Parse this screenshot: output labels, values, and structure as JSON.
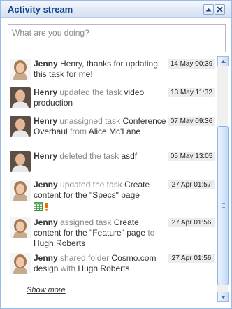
{
  "panel": {
    "title": "Activity stream",
    "collapse_icon": "chevron-up-icon",
    "close_icon": "close-icon"
  },
  "status_input": {
    "placeholder": "What are you doing?",
    "value": ""
  },
  "entries": [
    {
      "actor": "Jenny",
      "avatar": "woman-avatar",
      "text": "Henry, thanks for updating this task for me!",
      "time": "14 May 00:39"
    },
    {
      "actor": "Henry",
      "avatar": "man-avatar",
      "verb": "updated the task",
      "object": "video production",
      "time": "13 May 11:32"
    },
    {
      "actor": "Henry",
      "avatar": "man-avatar",
      "verb": "unassigned task",
      "object": "Conference Overhaul",
      "prep": "from",
      "target": "Alice Mc'Lane",
      "time": "07 May 09:36"
    },
    {
      "actor": "Henry",
      "avatar": "man-avatar",
      "verb": "deleted the task",
      "object": "asdf",
      "time": "05 May 13:05"
    },
    {
      "actor": "Jenny",
      "avatar": "woman-avatar",
      "verb": "updated the task",
      "object": "Create content for the \"Specs\" page",
      "icons": [
        "spreadsheet-icon",
        "priority-high-icon"
      ],
      "time": "27 Apr 01:57"
    },
    {
      "actor": "Jenny",
      "avatar": "woman-avatar",
      "verb": "assigned task",
      "object": "Create content for the \"Feature\" page",
      "prep": "to",
      "target": "Hugh Roberts",
      "time": "27 Apr 01:56"
    },
    {
      "actor": "Jenny",
      "avatar": "woman-avatar",
      "verb": "shared folder",
      "object": "Cosmo.com design",
      "prep": "with",
      "target": "Hugh Roberts",
      "time": "27 Apr 01:56"
    }
  ],
  "show_more": "Show more",
  "colors": {
    "header_title": "#15428b",
    "panel_border": "#99bbe8",
    "verb_gray": "#888888",
    "timestamp_bg": "#ececec",
    "priority": "#e8740c"
  }
}
